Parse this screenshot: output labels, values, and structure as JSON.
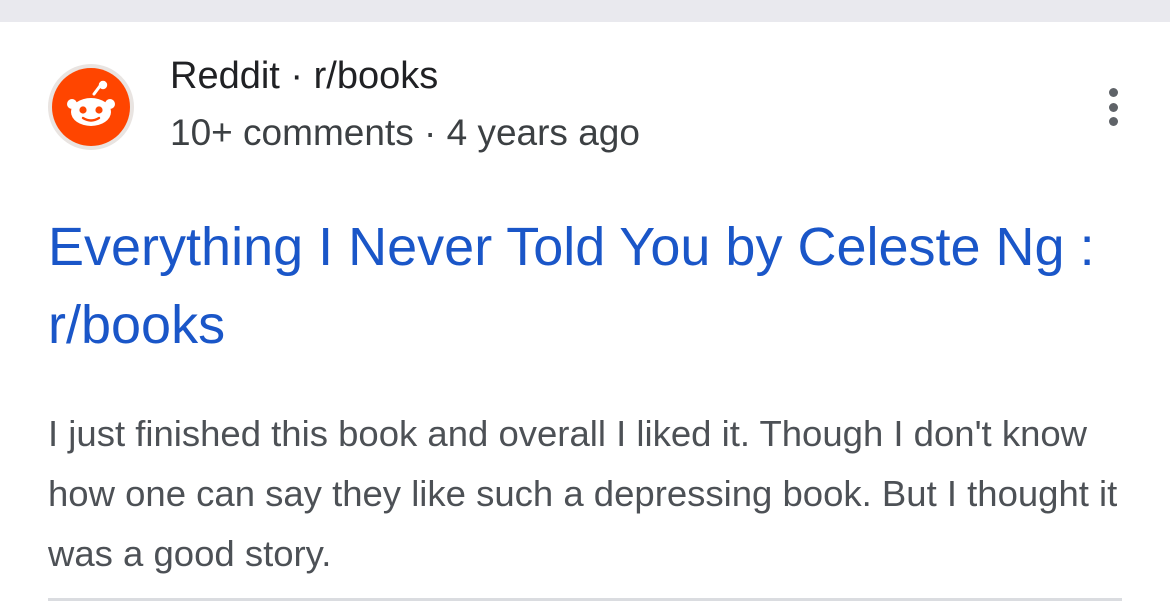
{
  "result": {
    "site_name": "Reddit",
    "separator": "·",
    "subreddit": "r/books",
    "comments": "10+ comments",
    "age": "4 years ago",
    "title": "Everything I Never Told You by Celeste Ng : r/books",
    "snippet": "I just finished this book and overall I liked it. Though I don't know how one can say they like such a depressing book. But I thought it was a good story."
  },
  "icons": {
    "favicon": "reddit-logo-icon",
    "menu": "more-vert-icon"
  },
  "colors": {
    "title_link": "#1a56c8",
    "brand": "#ff4500",
    "background": "#ffffff",
    "top_band": "#e9e9ee"
  }
}
